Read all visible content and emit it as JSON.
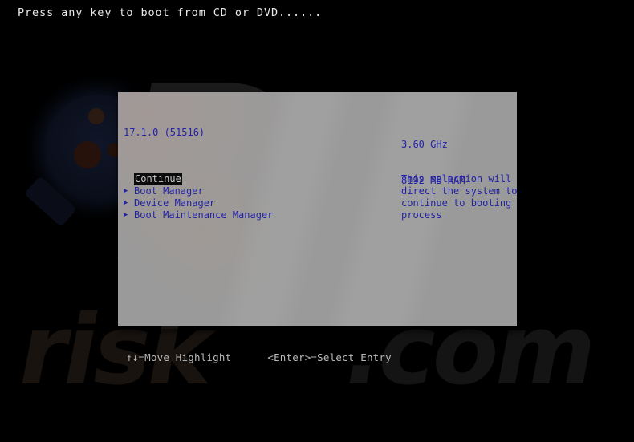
{
  "screen": {
    "background_color": "#000000",
    "boot_prompt": "Press any key to boot from CD or DVD......"
  },
  "watermark": {
    "logo_icon": "magnifying-glass-icon",
    "letter": "P",
    "wordmark": "risk",
    "wordmark_tail": ".com",
    "color": "#19130f"
  },
  "bios_panel": {
    "background_color": "#9a9a9a",
    "text_color": "#2222a8",
    "version": "17.1.0 (51516)",
    "specs": [
      "3.60 GHz",
      "8192 MB RAM"
    ],
    "menu": {
      "selected_index": 0,
      "selected_bg_color": "#0b0b0b",
      "selected_fg_color": "#c9c9c9",
      "items": [
        {
          "label": "Continue",
          "marker": "",
          "selected": true
        },
        {
          "label": "Boot Manager",
          "marker": "▶",
          "selected": false
        },
        {
          "label": "Device Manager",
          "marker": "▶",
          "selected": false
        },
        {
          "label": "Boot Maintenance Manager",
          "marker": "▶",
          "selected": false
        }
      ]
    },
    "help_text_lines": [
      "This selection will",
      "direct the system to",
      "continue to booting",
      "process"
    ]
  },
  "footer": {
    "hints": [
      "↑↓=Move Highlight",
      "<Enter>=Select Entry"
    ],
    "text_color": "#b9b9b9"
  }
}
